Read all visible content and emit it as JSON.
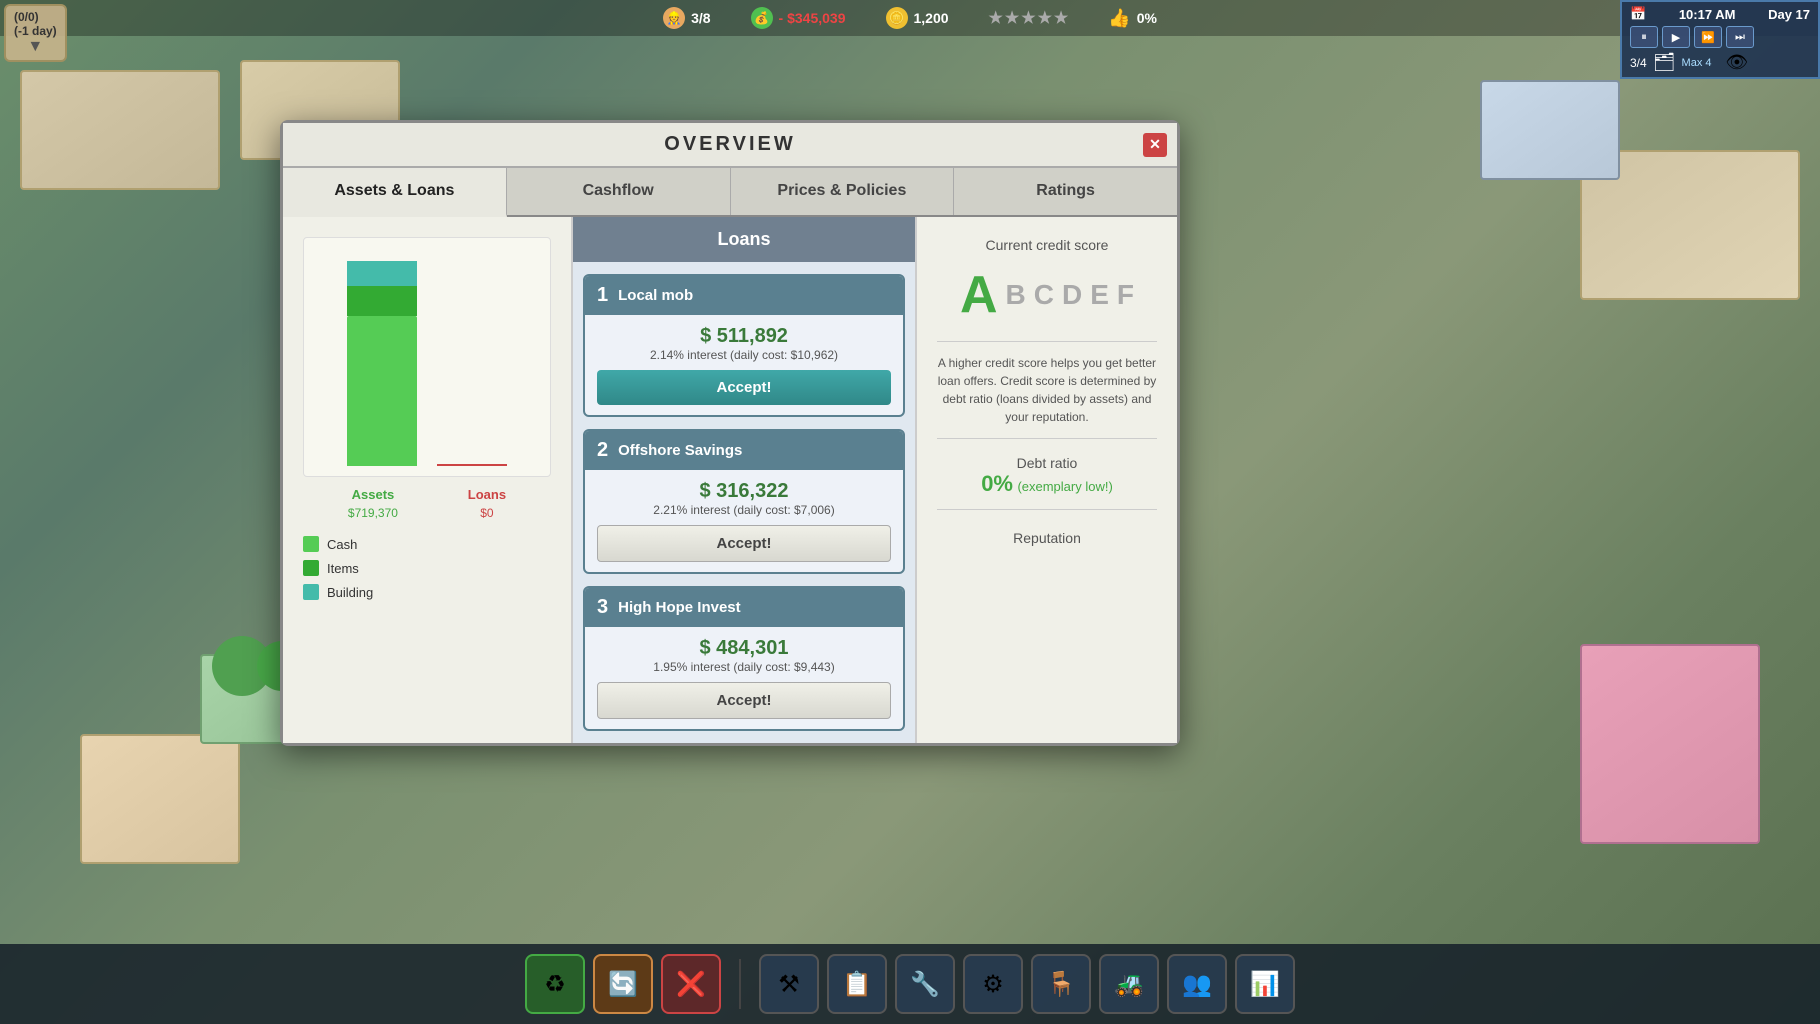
{
  "hud": {
    "workers": "3/8",
    "balance": "- $345,039",
    "coins": "1,200",
    "approval": "0%",
    "time": "10:17 AM",
    "day": "Day 17"
  },
  "top_left": {
    "line1": "(0/0)",
    "line2": "(-1 day)"
  },
  "modal": {
    "title": "OVERVIEW",
    "close_label": "✕",
    "tabs": [
      {
        "id": "assets-loans",
        "label": "Assets & Loans",
        "active": true
      },
      {
        "id": "cashflow",
        "label": "Cashflow",
        "active": false
      },
      {
        "id": "prices-policies",
        "label": "Prices & Policies",
        "active": false
      },
      {
        "id": "ratings",
        "label": "Ratings",
        "active": false
      }
    ],
    "chart": {
      "assets_label": "Assets",
      "assets_value": "$719,370",
      "loans_label": "Loans",
      "loans_value": "$0",
      "legend": [
        {
          "color": "#44cc44",
          "label": "Cash"
        },
        {
          "color": "#33aa33",
          "label": "Items"
        },
        {
          "color": "#44bbaa",
          "label": "Building"
        }
      ]
    },
    "loans": {
      "title": "Loans",
      "items": [
        {
          "num": "1",
          "name": "Local mob",
          "amount": "$ 511,892",
          "interest": "2.14% interest (daily cost: $10,962)",
          "btn_label": "Accept!",
          "btn_type": "primary"
        },
        {
          "num": "2",
          "name": "Offshore Savings",
          "amount": "$ 316,322",
          "interest": "2.21% interest (daily cost: $7,006)",
          "btn_label": "Accept!",
          "btn_type": "secondary"
        },
        {
          "num": "3",
          "name": "High Hope Invest",
          "amount": "$ 484,301",
          "interest": "1.95% interest (daily cost: $9,443)",
          "btn_label": "Accept!",
          "btn_type": "secondary"
        }
      ]
    },
    "credit": {
      "title": "Current credit score",
      "current_grade": "A",
      "grades": [
        "A",
        "B",
        "C",
        "D",
        "E",
        "F"
      ],
      "info": "A higher credit score helps you get better loan offers. Credit score is determined by debt ratio (loans divided by assets) and your reputation.",
      "debt_title": "Debt ratio",
      "debt_value": "0%",
      "debt_label": "(exemplary low!)",
      "reputation_title": "Reputation"
    }
  },
  "toolbar": {
    "buttons": [
      {
        "icon": "🗑",
        "type": "trash"
      },
      {
        "icon": "🔄",
        "type": "warning"
      },
      {
        "icon": "❌",
        "type": "cancel"
      },
      {
        "sep": true
      },
      {
        "icon": "⚒",
        "type": "normal"
      },
      {
        "icon": "📋",
        "type": "normal"
      },
      {
        "icon": "🔧",
        "type": "normal"
      },
      {
        "icon": "⚙",
        "type": "normal"
      },
      {
        "icon": "🪑",
        "type": "normal"
      },
      {
        "icon": "🚜",
        "type": "normal"
      },
      {
        "icon": "👥",
        "type": "normal"
      },
      {
        "icon": "📊",
        "type": "normal"
      }
    ]
  }
}
